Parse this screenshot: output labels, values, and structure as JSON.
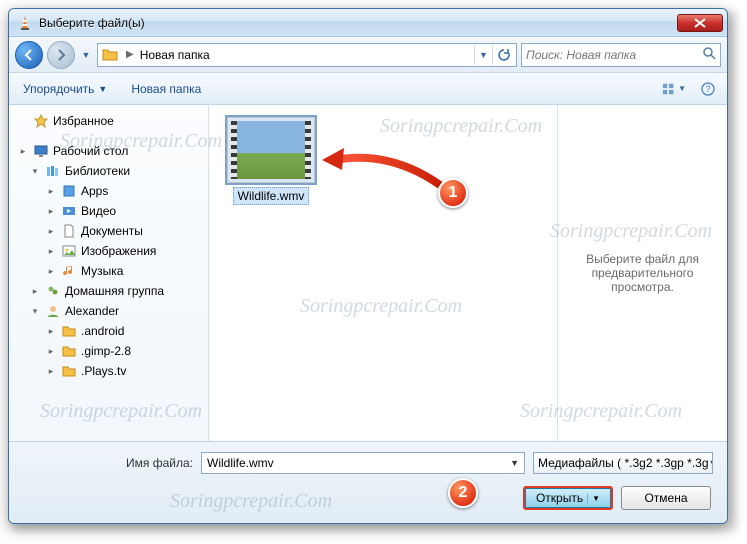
{
  "title": "Выберите файл(ы)",
  "nav": {
    "path_segment": "Новая папка",
    "search_placeholder": "Поиск: Новая папка"
  },
  "toolbar": {
    "organize": "Упорядочить",
    "newfolder": "Новая папка"
  },
  "sidebar": {
    "favorites": "Избранное",
    "desktop": "Рабочий стол",
    "libraries": "Библиотеки",
    "apps": "Apps",
    "video": "Видео",
    "documents": "Документы",
    "pictures": "Изображения",
    "music": "Музыка",
    "homegroup": "Домашняя группа",
    "user": "Alexander",
    "f1": ".android",
    "f2": ".gimp-2.8",
    "f3": ".Plays.tv"
  },
  "file": {
    "name": "Wildlife.wmv"
  },
  "preview": {
    "text": "Выберите файл для предварительного просмотра."
  },
  "footer": {
    "filename_label": "Имя файла:",
    "filename_value": "Wildlife.wmv",
    "filter": "Медиафайлы ( *.3g2 *.3gp *.3g",
    "open": "Открыть",
    "cancel": "Отмена"
  },
  "callouts": {
    "c1": "1",
    "c2": "2"
  },
  "watermark": "Soringpcrepair.Com"
}
